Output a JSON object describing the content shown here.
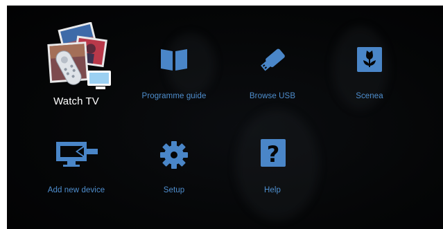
{
  "menu": {
    "items": [
      {
        "id": "watch-tv",
        "label": "Watch TV",
        "selected": true,
        "icon": "tv-remote-photos-icon"
      },
      {
        "id": "programme-guide",
        "label": "Programme guide",
        "selected": false,
        "icon": "book-icon"
      },
      {
        "id": "browse-usb",
        "label": "Browse USB",
        "selected": false,
        "icon": "usb-stick-icon"
      },
      {
        "id": "scenea",
        "label": "Scenea",
        "selected": false,
        "icon": "flower-frame-icon"
      },
      {
        "id": "add-new-device",
        "label": "Add new device",
        "selected": false,
        "icon": "monitor-input-icon"
      },
      {
        "id": "setup",
        "label": "Setup",
        "selected": false,
        "icon": "gear-icon"
      },
      {
        "id": "help",
        "label": "Help",
        "selected": false,
        "icon": "question-icon"
      }
    ]
  },
  "colors": {
    "icon": "#4a86c8",
    "label": "#4f8fcf",
    "selected_label": "#ffffff",
    "background": "#050607"
  }
}
